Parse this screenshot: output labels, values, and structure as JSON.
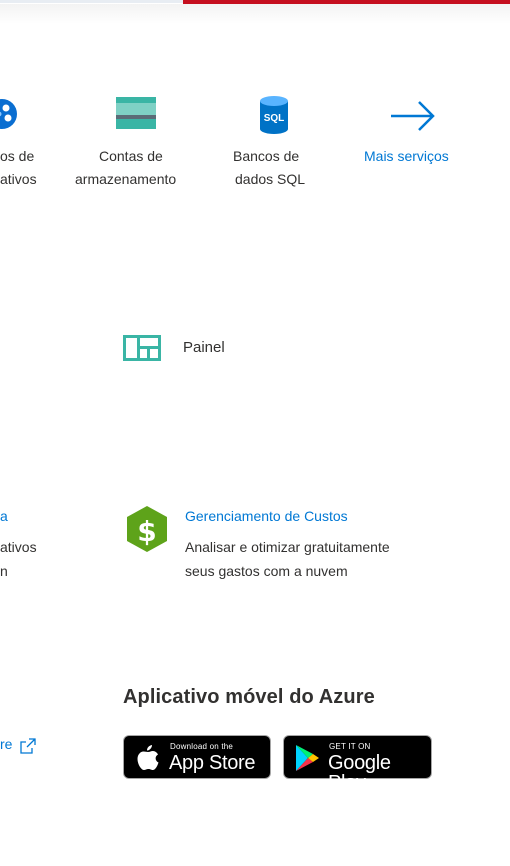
{
  "services": [
    {
      "name": "dispositivos",
      "line1": "os de",
      "line2": "ativos"
    },
    {
      "name": "storage",
      "line1": "Contas de",
      "line2": "armazenamento"
    },
    {
      "name": "sql",
      "line1": "Bancos de",
      "line2": "dados SQL",
      "icon_text": "SQL"
    },
    {
      "name": "more",
      "label": "Mais serviços"
    }
  ],
  "painel": {
    "label": "Painel"
  },
  "left_fragments": {
    "link_fragment": "a",
    "desc1": "ativos",
    "desc2": "n",
    "bottom_link": "re"
  },
  "cost": {
    "title": "Gerenciamento de Custos",
    "desc1": "Analisar e otimizar gratuitamente",
    "desc2": "seus gastos com a nuvem"
  },
  "mobile": {
    "heading": "Aplicativo móvel do Azure",
    "appstore_sub": "Download on the",
    "appstore_main": "App Store",
    "googleplay_sub": "GET IT ON",
    "googleplay_main": "Google Play"
  },
  "colors": {
    "accent": "#0078d4",
    "topbar_red": "#c50f1f",
    "cost_green": "#5ea31a",
    "storage_teal": "#3ab5a5"
  }
}
